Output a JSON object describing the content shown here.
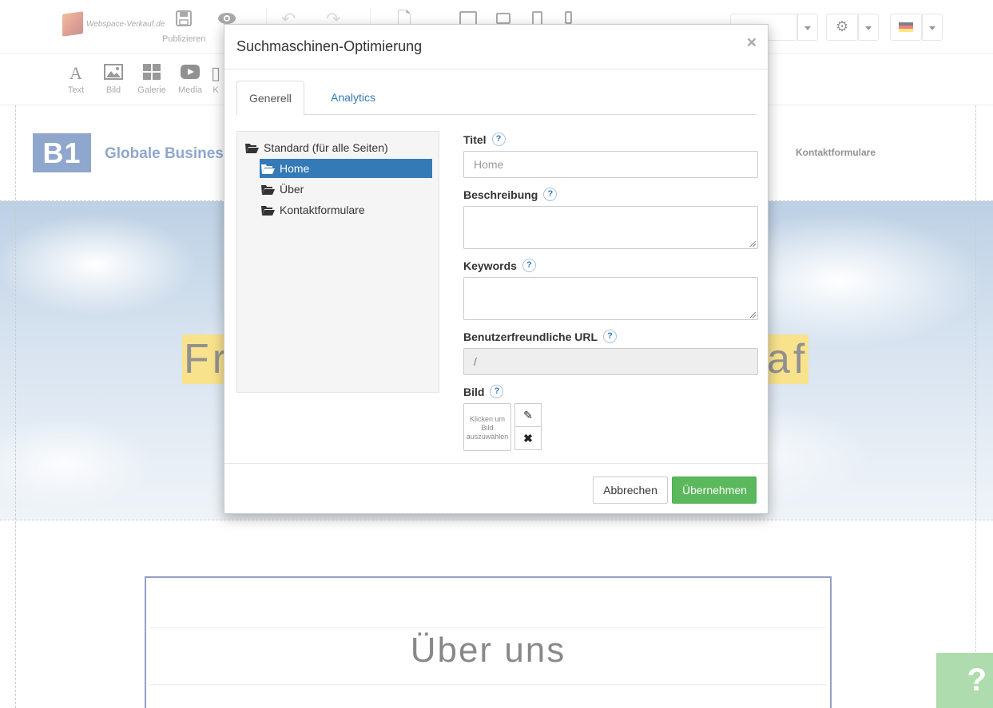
{
  "editor": {
    "logo_text": "Webspace-Verkauf.de",
    "publish_label": "Publizieren",
    "preview_label_partial": "V",
    "widgets": [
      {
        "label": "Text",
        "icon": "text-icon"
      },
      {
        "label": "Bild",
        "icon": "image-icon"
      },
      {
        "label": "Galerie",
        "icon": "gallery-icon"
      },
      {
        "label": "Media",
        "icon": "media-icon"
      },
      {
        "label": "K",
        "icon": "widget-icon"
      }
    ],
    "accent_color": "#5cb85c"
  },
  "site": {
    "logo_text": "B1",
    "brand_name": "Globale Busines",
    "nav_contact": "Kontaktformulare",
    "hero_left_fragment": "Fr",
    "hero_right_fragment": "aft",
    "about_title": "Über uns",
    "help_symbol": "?"
  },
  "modal": {
    "title": "Suchmaschinen-Optimierung",
    "close_symbol": "×",
    "tabs": [
      {
        "label": "Generell",
        "active": true
      },
      {
        "label": "Analytics",
        "active": false
      }
    ],
    "tree": {
      "root": "Standard (für alle Seiten)",
      "children": [
        "Home",
        "Über",
        "Kontaktformulare"
      ],
      "selected": "Home"
    },
    "fields": {
      "title_label": "Titel",
      "title_placeholder": "Home",
      "description_label": "Beschreibung",
      "keywords_label": "Keywords",
      "url_label": "Benutzerfreundliche URL",
      "url_value": "/",
      "image_label": "Bild",
      "image_placeholder": "Klicken um Bild auszuwählen",
      "help_symbol": "?"
    },
    "buttons": {
      "cancel": "Abbrechen",
      "apply": "Übernehmen"
    }
  }
}
